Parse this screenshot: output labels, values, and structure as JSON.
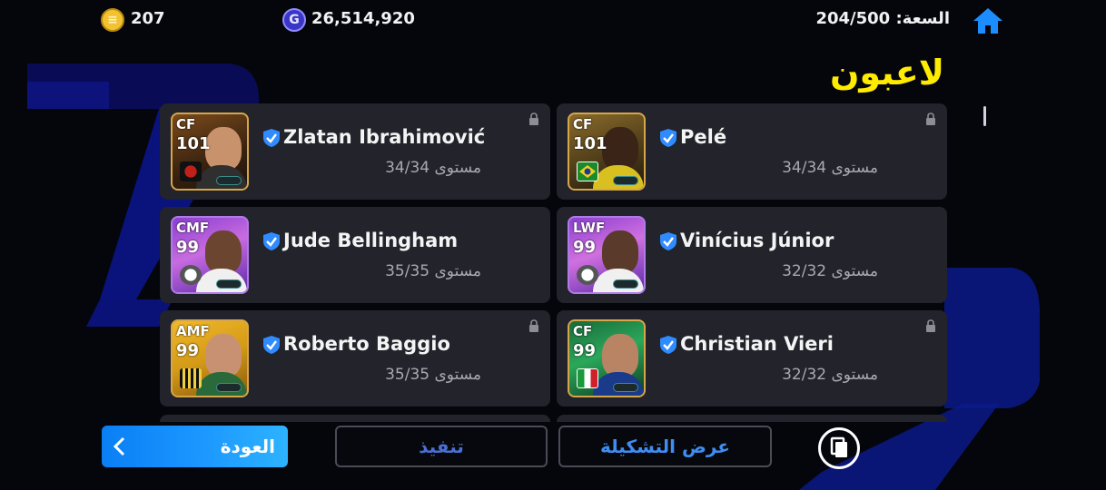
{
  "header": {
    "coins_value": "207",
    "coins_icon": "e-coin-icon",
    "gp_value": "26,514,920",
    "gp_icon": "gp-coin-icon",
    "capacity_label": "السعة:",
    "capacity_value": "204/500",
    "home_icon": "home-icon"
  },
  "page_title": "لاعبون",
  "players": [
    {
      "name": "Zlatan Ibrahimović",
      "position": "CF",
      "rating": "101",
      "level": "مستوى 34/34",
      "locked": true,
      "emblem": "club-emblem-icon"
    },
    {
      "name": "Pelé",
      "position": "CF",
      "rating": "101",
      "level": "مستوى 34/34",
      "locked": true,
      "emblem": "brazil-flag-icon"
    },
    {
      "name": "Jude Bellingham",
      "position": "CMF",
      "rating": "99",
      "level": "مستوى 35/35",
      "locked": false,
      "emblem": "club-emblem-icon"
    },
    {
      "name": "Vinícius Júnior",
      "position": "LWF",
      "rating": "99",
      "level": "مستوى 32/32",
      "locked": false,
      "emblem": "club-emblem-icon"
    },
    {
      "name": "Roberto Baggio",
      "position": "AMF",
      "rating": "99",
      "level": "مستوى 35/35",
      "locked": true,
      "emblem": "club-emblem-icon"
    },
    {
      "name": "Christian Vieri",
      "position": "CF",
      "rating": "99",
      "level": "مستوى 32/32",
      "locked": true,
      "emblem": "italy-flag-icon"
    }
  ],
  "buttons": {
    "back_label": "العودة",
    "execute_label": "تنفيذ",
    "show_formation_label": "عرض التشكيلة"
  },
  "colors": {
    "accent_yellow": "#ffec00",
    "accent_blue": "#1c98ff",
    "card_bg": "#22232b",
    "background": "#05060c"
  }
}
